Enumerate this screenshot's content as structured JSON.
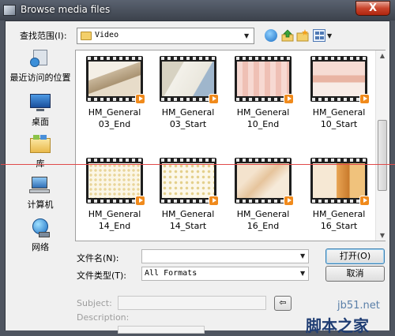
{
  "window": {
    "title": "Browse media files",
    "close_label": "X"
  },
  "toolbar": {
    "look_in_label": "查找范围(I):",
    "look_in_value": "Video",
    "icons": [
      "back-icon",
      "up-folder-icon",
      "new-folder-icon",
      "view-menu-icon"
    ]
  },
  "places": [
    {
      "label": "最近访问的位置",
      "icon": "recent-places-icon"
    },
    {
      "label": "桌面",
      "icon": "desktop-icon"
    },
    {
      "label": "库",
      "icon": "libraries-icon"
    },
    {
      "label": "计算机",
      "icon": "computer-icon"
    },
    {
      "label": "网络",
      "icon": "network-icon"
    }
  ],
  "files": [
    {
      "line1": "HM_General",
      "line2": "03_End"
    },
    {
      "line1": "HM_General",
      "line2": "03_Start"
    },
    {
      "line1": "HM_General",
      "line2": "10_End"
    },
    {
      "line1": "HM_General",
      "line2": "10_Start"
    },
    {
      "line1": "HM_General",
      "line2": "14_End"
    },
    {
      "line1": "HM_General",
      "line2": "14_Start"
    },
    {
      "line1": "HM_General",
      "line2": "16_End"
    },
    {
      "line1": "HM_General",
      "line2": "16_Start"
    }
  ],
  "form": {
    "filename_label": "文件名(N):",
    "filename_value": "",
    "filetype_label": "文件类型(T):",
    "filetype_value": "All Formats",
    "open_label": "打开(O)",
    "cancel_label": "取消",
    "subject_label": "Subject:",
    "description_label": "Description:"
  },
  "watermark": {
    "site": "jb51.net",
    "name": "脚本之家"
  }
}
